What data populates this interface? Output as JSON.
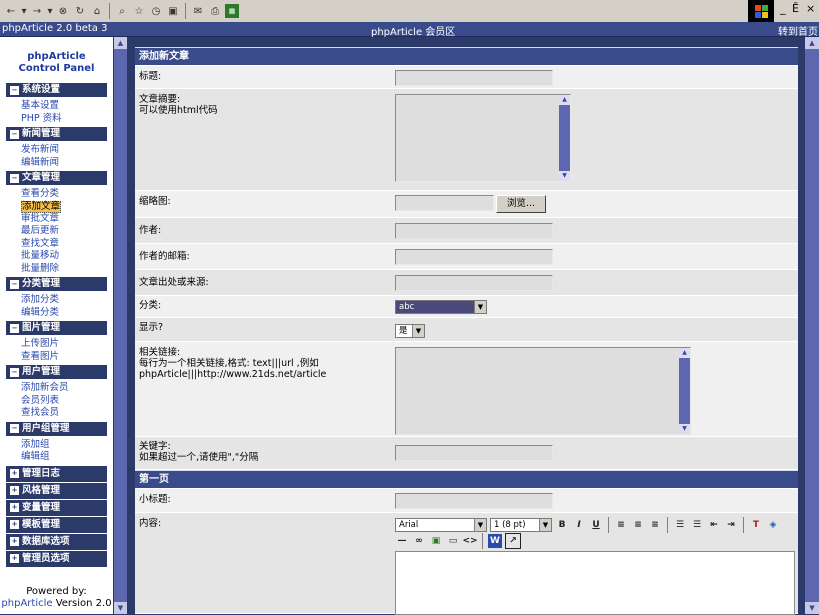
{
  "browser": {
    "back_icon": "back-arrow",
    "forward_icon": "forward-arrow",
    "menu_min": "_",
    "menu_restore": "Ē",
    "menu_close": "×"
  },
  "header": {
    "left": "phpArticle 2.0 beta 3",
    "center": "phpArticle 会员区",
    "right": "转到首页"
  },
  "sidebar": {
    "brand_line1": "phpArticle",
    "brand_line2": "Control Panel",
    "groups": [
      {
        "title": "系统设置",
        "links": [
          "基本设置",
          "PHP 资料"
        ]
      },
      {
        "title": "新闻管理",
        "links": [
          "发布新闻",
          "编辑新闻"
        ]
      },
      {
        "title": "文章管理",
        "links": [
          "查看分类",
          "添加文章",
          "审批文章",
          "最后更新",
          "查找文章",
          "批量移动",
          "批量删除"
        ]
      },
      {
        "title": "分类管理",
        "links": [
          "添加分类",
          "编辑分类"
        ]
      },
      {
        "title": "图片管理",
        "links": [
          "上传图片",
          "查看图片"
        ]
      },
      {
        "title": "用户管理",
        "links": [
          "添加新会员",
          "会员列表",
          "查找会员"
        ]
      },
      {
        "title": "用户组管理",
        "links": [
          "添加组",
          "编辑组"
        ]
      }
    ],
    "collapsed": [
      "管理日志",
      "风格管理",
      "变量管理",
      "模板管理",
      "数据库选项",
      "管理员选项"
    ],
    "powered_by": "Powered by:",
    "powered_link": "phpArticle",
    "powered_version": " Version 2.0"
  },
  "form": {
    "section_title": "添加新文章",
    "fields": {
      "title": "标题:",
      "summary_l1": "文章摘要:",
      "summary_l2": "可以使用html代码",
      "thumb": "缩略图:",
      "browse": "浏览...",
      "author": "作者:",
      "author_email": "作者的邮箱:",
      "source": "文章出处或来源:",
      "category": "分类:",
      "category_value": "abc",
      "display": "显示?",
      "display_value": "是",
      "related_l1": "相关链接:",
      "related_l2": "每行为一个相关链接,格式: text|||url ,例如",
      "related_l3": "phpArticle|||http://www.21ds.net/article",
      "keywords_l1": "关键字:",
      "keywords_l2": "如果超过一个,请使用\",\"分隔"
    },
    "page_section": "第一页",
    "subtitle": "小标题:",
    "content": "内容:",
    "editor": {
      "font": "Arial",
      "size": "1 (8 pt)",
      "bold": "B",
      "italic": "I",
      "underline": "U"
    }
  }
}
